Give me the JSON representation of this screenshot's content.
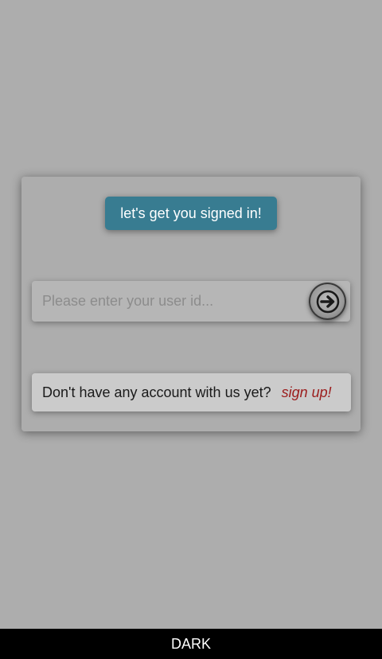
{
  "card": {
    "banner_text": "let's get you signed in!",
    "input_placeholder": "Please enter your user id...",
    "input_value": "",
    "submit_icon": "arrow-right-icon",
    "signup_prompt": "Don't have any account with us yet?",
    "signup_link": "sign up!"
  },
  "bottom_bar": {
    "label": "DARK"
  },
  "colors": {
    "background": "#adadad",
    "banner": "#387c91",
    "link": "#9b1c1c",
    "bottom_bar": "#000000"
  }
}
